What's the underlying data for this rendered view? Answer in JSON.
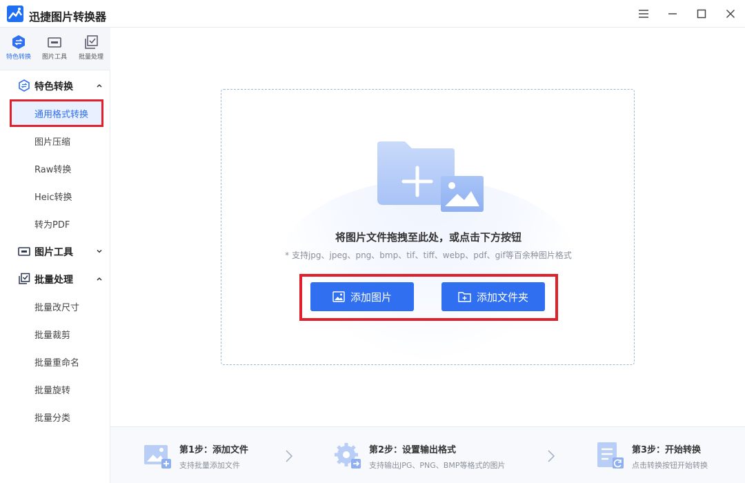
{
  "app": {
    "title": "迅捷图片转换器"
  },
  "topnav": [
    {
      "label": "特色转换",
      "icon": "convert-icon",
      "active": true
    },
    {
      "label": "图片工具",
      "icon": "image-tool-icon",
      "active": false
    },
    {
      "label": "批量处理",
      "icon": "batch-icon",
      "active": false
    }
  ],
  "sidebar": {
    "groups": [
      {
        "label": "特色转换",
        "icon": "convert-icon",
        "expanded": true
      },
      {
        "label": "图片工具",
        "icon": "image-tool-icon",
        "expanded": false
      },
      {
        "label": "批量处理",
        "icon": "batch-icon",
        "expanded": true
      }
    ],
    "items": [
      "通用格式转换",
      "图片压缩",
      "Raw转换",
      "Heic转换",
      "转为PDF",
      "批量改尺寸",
      "批量裁剪",
      "批量重命名",
      "批量旋转",
      "批量分类"
    ],
    "active_item": "通用格式转换"
  },
  "dropzone": {
    "title": "将图片文件拖拽至此处，或点击下方按钮",
    "hint": "* 支持jpg、jpeg、png、bmp、tif、tiff、webp、pdf、gif等百余种图片格式",
    "add_image_label": "添加图片",
    "add_folder_label": "添加文件夹"
  },
  "steps": [
    {
      "title": "第1步：添加文件",
      "desc": "支持批量添加文件"
    },
    {
      "title": "第2步：设置输出格式",
      "desc": "支持输出JPG、PNG、BMP等格式的图片"
    },
    {
      "title": "第3步：开始转换",
      "desc": "点击转换按钮开始转换"
    }
  ],
  "colors": {
    "accent": "#2f6ff0",
    "highlight_border": "#e0202a",
    "active_bg": "#e9f0ff"
  }
}
